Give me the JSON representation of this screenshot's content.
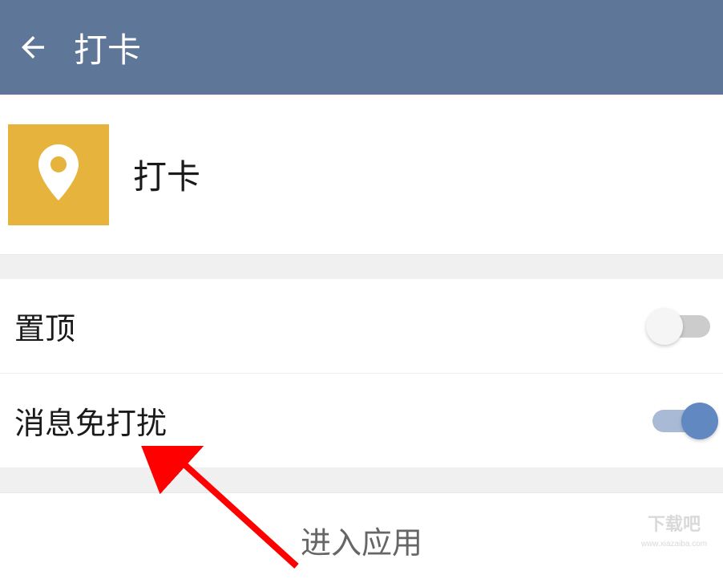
{
  "header": {
    "title": "打卡"
  },
  "app": {
    "name": "打卡",
    "iconColor": "#e6b33c"
  },
  "settings": {
    "pinTop": {
      "label": "置顶",
      "enabled": false
    },
    "doNotDisturb": {
      "label": "消息免打扰",
      "enabled": true
    }
  },
  "action": {
    "enterApp": "进入应用"
  },
  "watermark": {
    "text": "下载吧",
    "url": "www.xiazaiba.com"
  }
}
